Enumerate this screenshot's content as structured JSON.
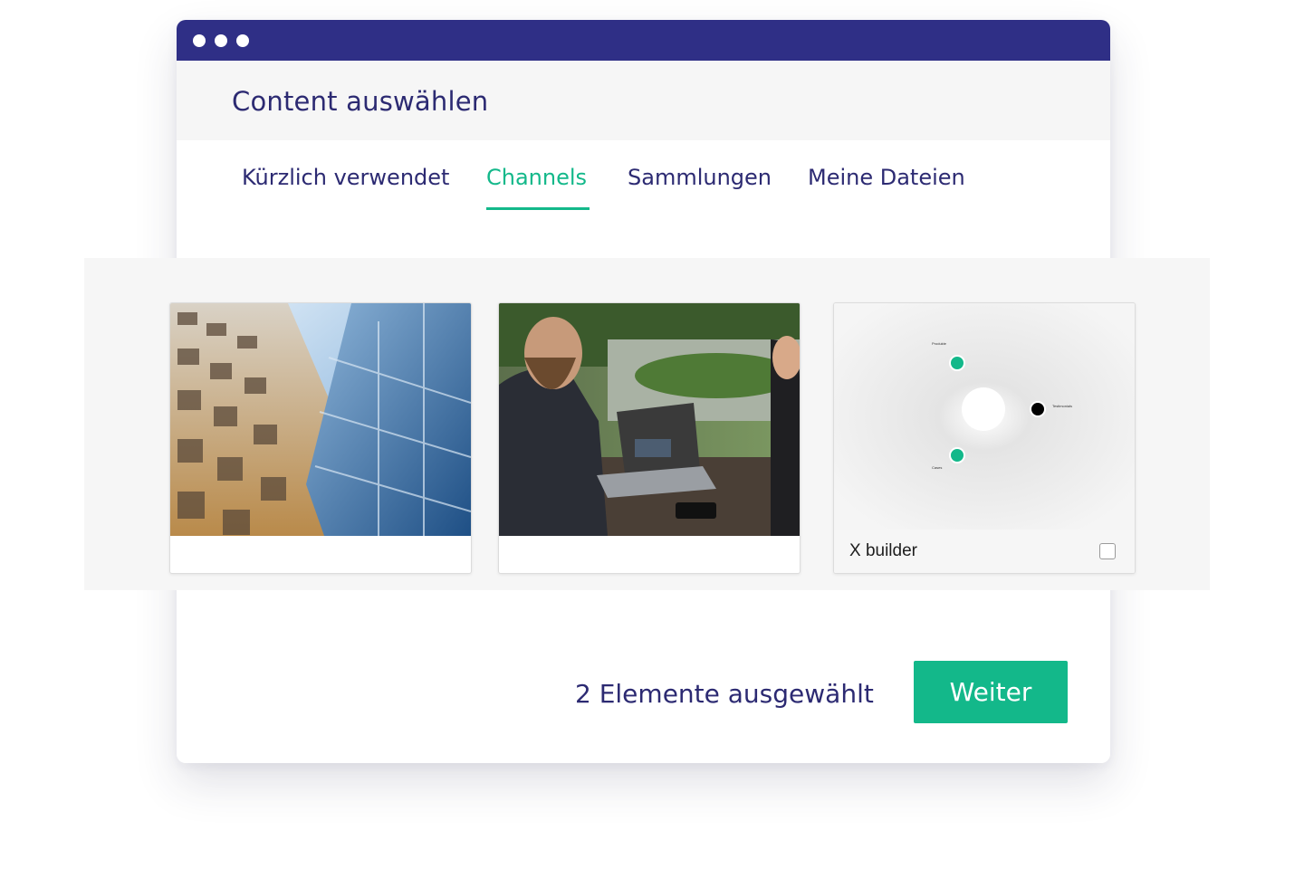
{
  "window": {
    "title": "Content auswählen"
  },
  "tabs": [
    {
      "label": "Kürzlich verwendet",
      "active": false
    },
    {
      "label": "Channels",
      "active": true
    },
    {
      "label": "Sammlungen",
      "active": false
    },
    {
      "label": "Meine Dateien",
      "active": false
    }
  ],
  "cards": [
    {
      "image": "office-building-photo",
      "label": "",
      "checkbox": false
    },
    {
      "image": "business-meeting-laptop-photo",
      "label": "",
      "checkbox": false
    },
    {
      "image": "x-builder-diagram",
      "label": "X builder",
      "checkbox": true,
      "checked": false,
      "diagram_labels": [
        "Produkte",
        "Testimonials",
        "Cases"
      ]
    }
  ],
  "footer": {
    "status": "2 Elemente ausgewählt",
    "next_label": "Weiter"
  },
  "colors": {
    "titlebar": "#2f2f86",
    "primary_text": "#2c2a72",
    "accent": "#13b88a",
    "panel": "#f6f6f6"
  }
}
